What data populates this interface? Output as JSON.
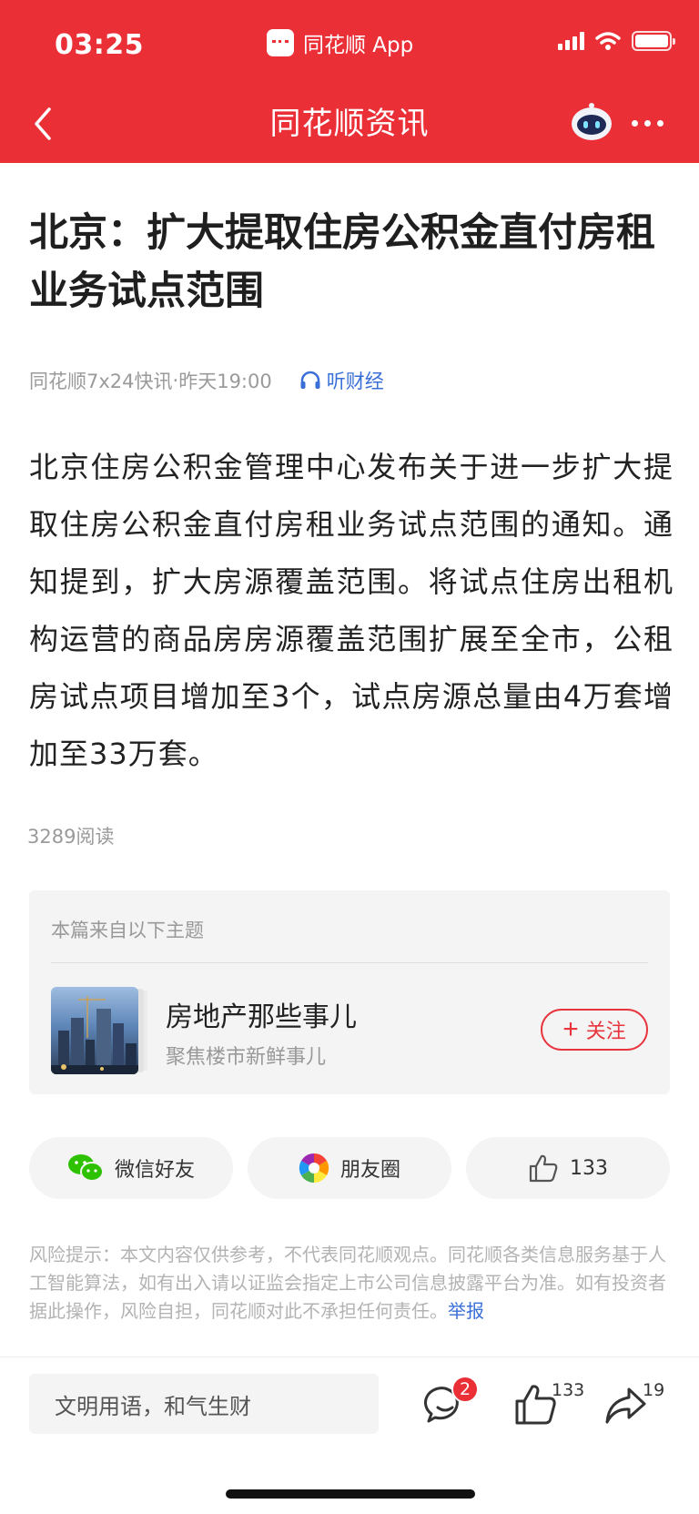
{
  "status_bar": {
    "time": "03:25",
    "app_name": "同花顺 App"
  },
  "nav": {
    "title": "同花顺资讯"
  },
  "article": {
    "headline": "北京：扩大提取住房公积金直付房租业务试点范围",
    "source": "同花顺7x24快讯",
    "separator": "·",
    "time": "昨天19:00",
    "listen_label": "听财经",
    "body": "北京住房公积金管理中心发布关于进一步扩大提取住房公积金直付房租业务试点范围的通知。通知提到，扩大房源覆盖范围。将试点住房出租机构运营的商品房房源覆盖范围扩展至全市，公租房试点项目增加至3个，试点房源总量由4万套增加至33万套。",
    "reads": "3289阅读"
  },
  "topic": {
    "heading": "本篇来自以下主题",
    "name": "房地产那些事儿",
    "subtitle": "聚焦楼市新鲜事儿",
    "follow_plus": "+",
    "follow_label": "关注"
  },
  "share": {
    "wechat_label": "微信好友",
    "moments_label": "朋友圈",
    "like_count": "133"
  },
  "disclaimer": {
    "text": "风险提示：本文内容仅供参考，不代表同花顺观点。同花顺各类信息服务基于人工智能算法，如有出入请以证监会指定上市公司信息披露平台为准。如有投资者据此操作，风险自担，同花顺对此不承担任何责任。",
    "report_label": "举报"
  },
  "bottom_bar": {
    "comment_placeholder": "文明用语，和气生财",
    "comment_badge": "2",
    "like_count": "133",
    "share_count": "19"
  },
  "colors": {
    "brand_red": "#ea2f37",
    "link_blue": "#3a6fd8"
  },
  "icons": [
    "back-icon",
    "robot-assistant-icon",
    "more-icon",
    "headphones-icon",
    "wechat-icon",
    "moments-icon",
    "thumbs-up-icon",
    "comment-icon",
    "share-icon"
  ]
}
